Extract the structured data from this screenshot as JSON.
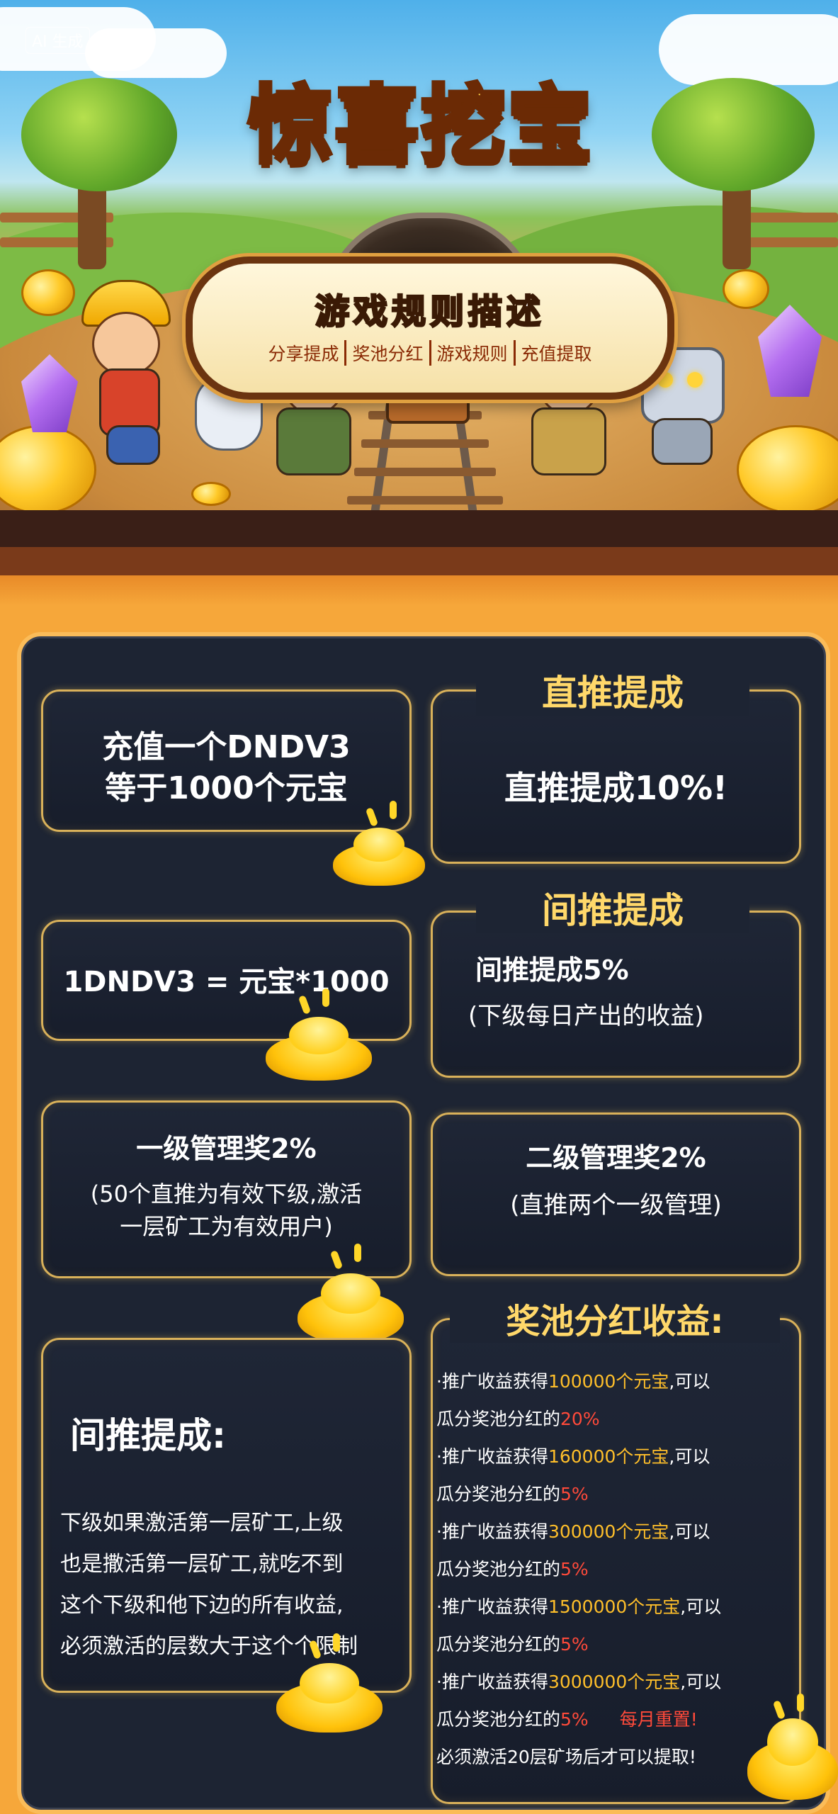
{
  "watermark": "AI 生成",
  "hero": {
    "title": "惊喜挖宝",
    "subtitle": "游戏规则描述",
    "tabs": [
      "分享提成",
      "奖池分红",
      "游戏规则",
      "充值提取"
    ]
  },
  "cards": {
    "recharge": {
      "line1": "充值一个DNDV3",
      "line2": "等于1000个元宝"
    },
    "formula": {
      "text": "1DNDV3 = 元宝*1000"
    },
    "direct": {
      "heading": "直推提成",
      "text": "直推提成10%!"
    },
    "indirect": {
      "heading": "间推提成",
      "line1": "间推提成5%",
      "line2": "(下级每日产出的收益)"
    },
    "level1": {
      "title": "一级管理奖2%",
      "line1": "(50个直推为有效下级,激活",
      "line2": "一层矿工为有效用户)"
    },
    "level2": {
      "title": "二级管理奖2%",
      "line1": "(直推两个一级管理)"
    },
    "rule": {
      "heading": "间推提成:",
      "lines": [
        "下级如果激活第一层矿工,上级",
        "也是撒活第一层矿工,就吃不到",
        "这个下级和他下边的所有收益,",
        "必须激活的层数大于这个个限制"
      ]
    },
    "pool": {
      "heading": "奖池分红收益:",
      "items": [
        {
          "prefix": "·推广收益获得",
          "amount": "100000个元宝",
          "suffix": ",可以",
          "line2": "瓜分奖池分红的",
          "pct": "20%"
        },
        {
          "prefix": "·推广收益获得",
          "amount": "160000个元宝",
          "suffix": ",可以",
          "line2": "瓜分奖池分红的",
          "pct": "5%"
        },
        {
          "prefix": "·推广收益获得",
          "amount": "300000个元宝",
          "suffix": ",可以",
          "line2": "瓜分奖池分红的",
          "pct": "5%"
        },
        {
          "prefix": "·推广收益获得",
          "amount": "1500000个元宝",
          "suffix": ",可以",
          "line2": "瓜分奖池分红的",
          "pct": "5%"
        },
        {
          "prefix": "·推广收益获得",
          "amount": "3000000个元宝",
          "suffix": ",可以",
          "line2": "瓜分奖池分红的",
          "pct": "5%"
        }
      ],
      "reset": "每月重置!",
      "footer": "必须激活20层矿场后才可以提取!"
    }
  }
}
